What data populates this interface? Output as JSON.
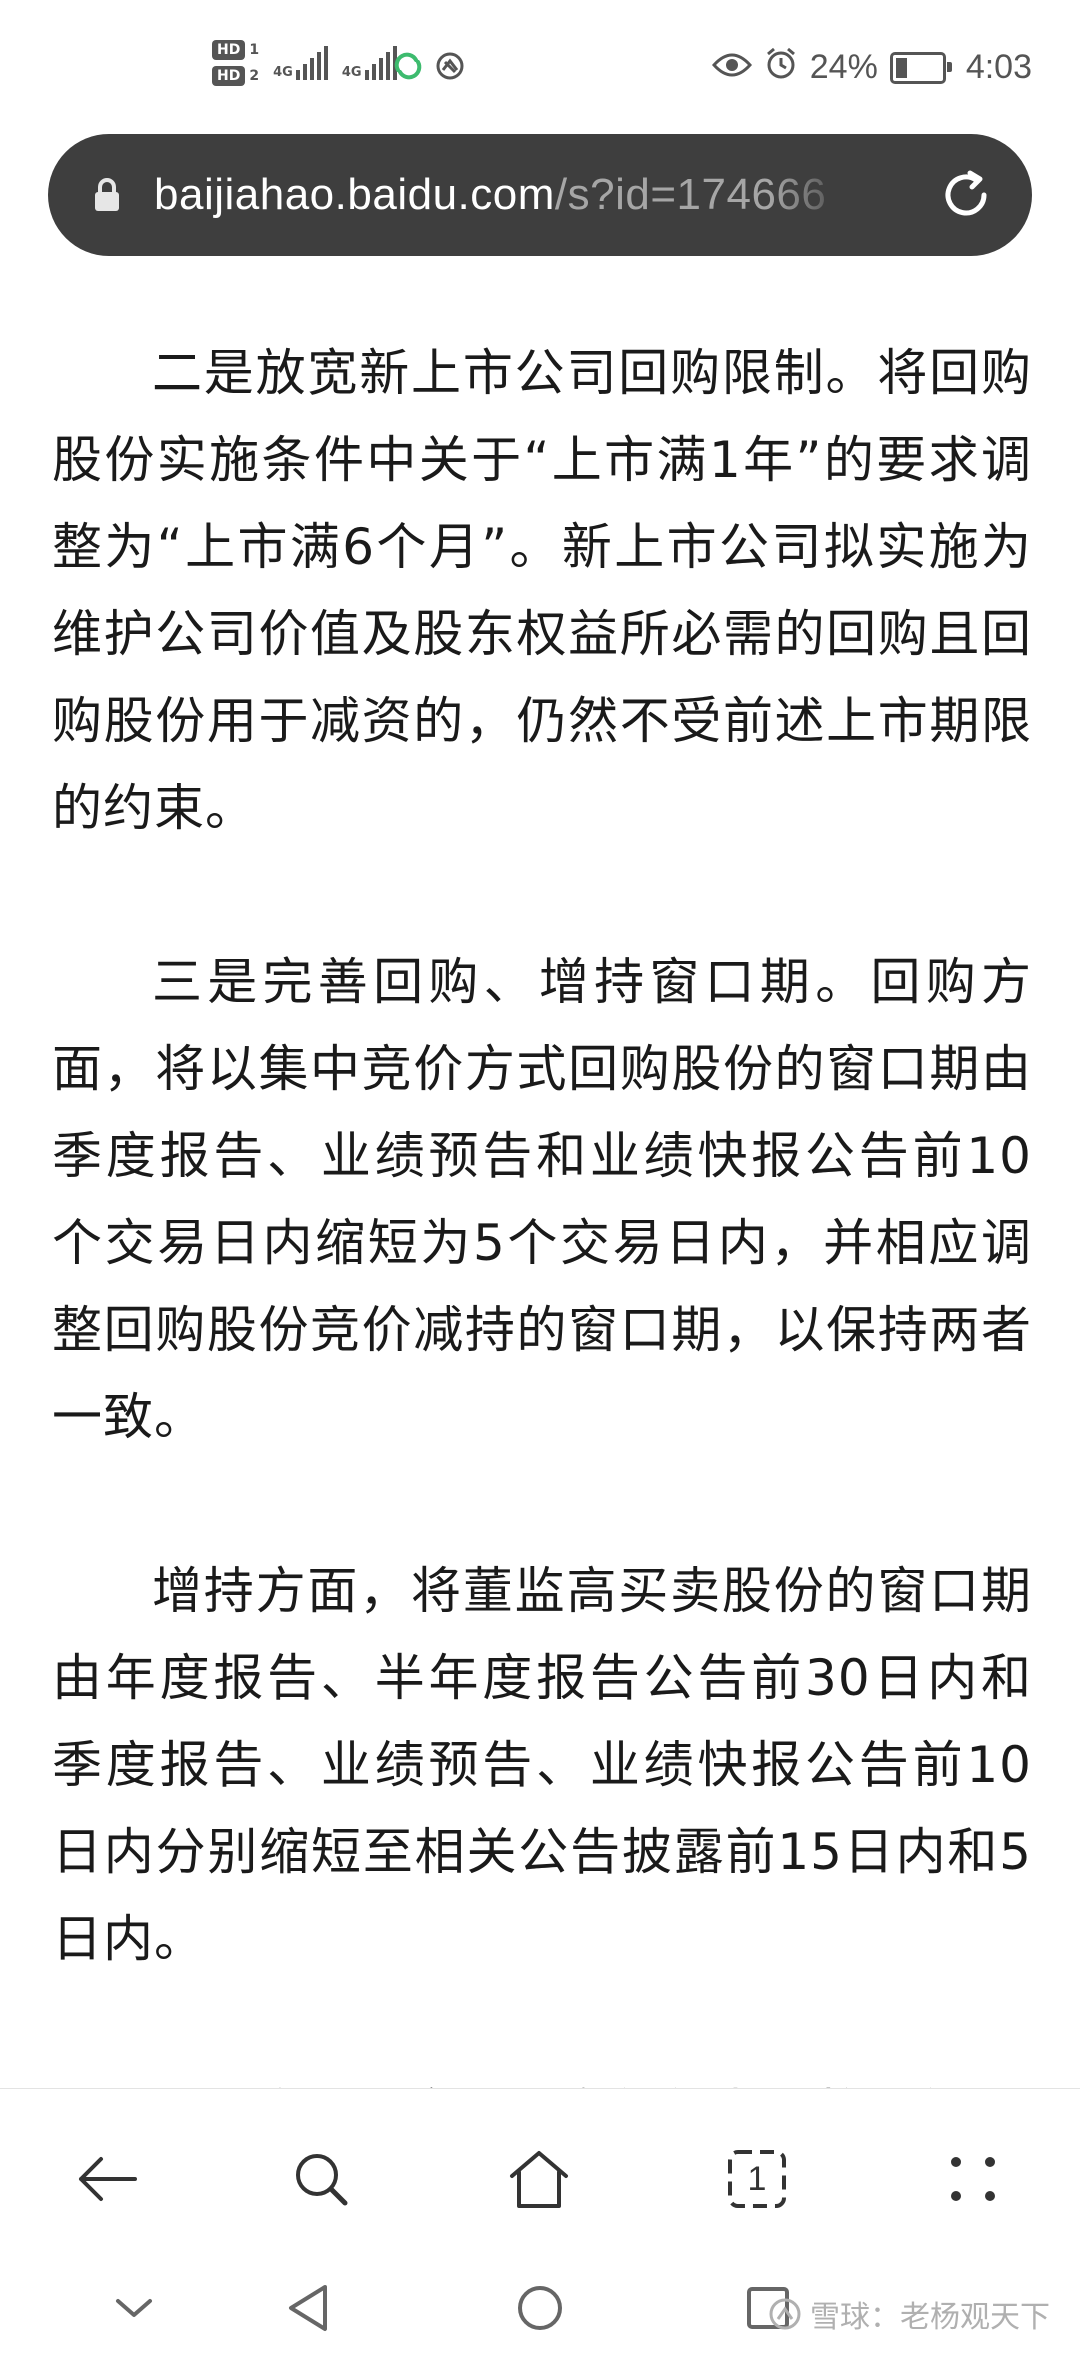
{
  "status_bar": {
    "sim1_label": "HD",
    "sim1_slot": "1",
    "sim2_label": "HD",
    "sim2_slot": "2",
    "network1": "4G",
    "network2": "4G",
    "battery_percent": "24%",
    "time": "4:03",
    "icons": [
      "hd-icon",
      "signal-icon",
      "signal-icon",
      "app-notification-icon",
      "app-notification-icon",
      "eye-comfort-icon",
      "alarm-icon",
      "battery-charging-icon"
    ]
  },
  "url_bar": {
    "domain": "baijiahao.baidu.com",
    "path": "/s?id=174666",
    "icons": [
      "lock-icon",
      "reload-icon"
    ]
  },
  "article": {
    "paragraphs": [
      "二是放宽新上市公司回购限制。将回购股份实施条件中关于“上市满1年”的要求调整为“上市满6个月”。新上市公司拟实施为维护公司价值及股东权益所必需的回购且回购股份用于减资的，仍然不受前述上市期限的约束。",
      "三是完善回购、增持窗口期。回购方面，将以集中竞价方式回购股份的窗口期由季度报告、业绩预告和业绩快报公告前10个交易日内缩短为5个交易日内，并相应调整回购股份竞价减持的窗口期，以保持两者一致。",
      "增持方面，将董监高买卖股份的窗口期由年度报告、半年度报告公告前30日内和季度报告、业绩预告、业绩快报公告前10日内分别缩短至相关公告披露前15日内和5日内。",
      "四是合理界定股份发行行为。将现行"
    ]
  },
  "toolbar": {
    "tab_count": "1",
    "icons": [
      "back-arrow-icon",
      "search-icon",
      "home-icon",
      "tabs-icon",
      "more-icon"
    ]
  },
  "system_nav": {
    "icons": [
      "collapse-icon",
      "back-triangle-icon",
      "home-circle-icon",
      "recents-square-icon"
    ]
  },
  "watermark": {
    "text": "雪球：老杨观天下"
  },
  "colors": {
    "url_bar_bg": "#3e3e3e",
    "url_domain": "#ffffff",
    "url_path": "#a6a6a6",
    "body_text": "#1a1a1a",
    "status_icon": "#555555"
  }
}
